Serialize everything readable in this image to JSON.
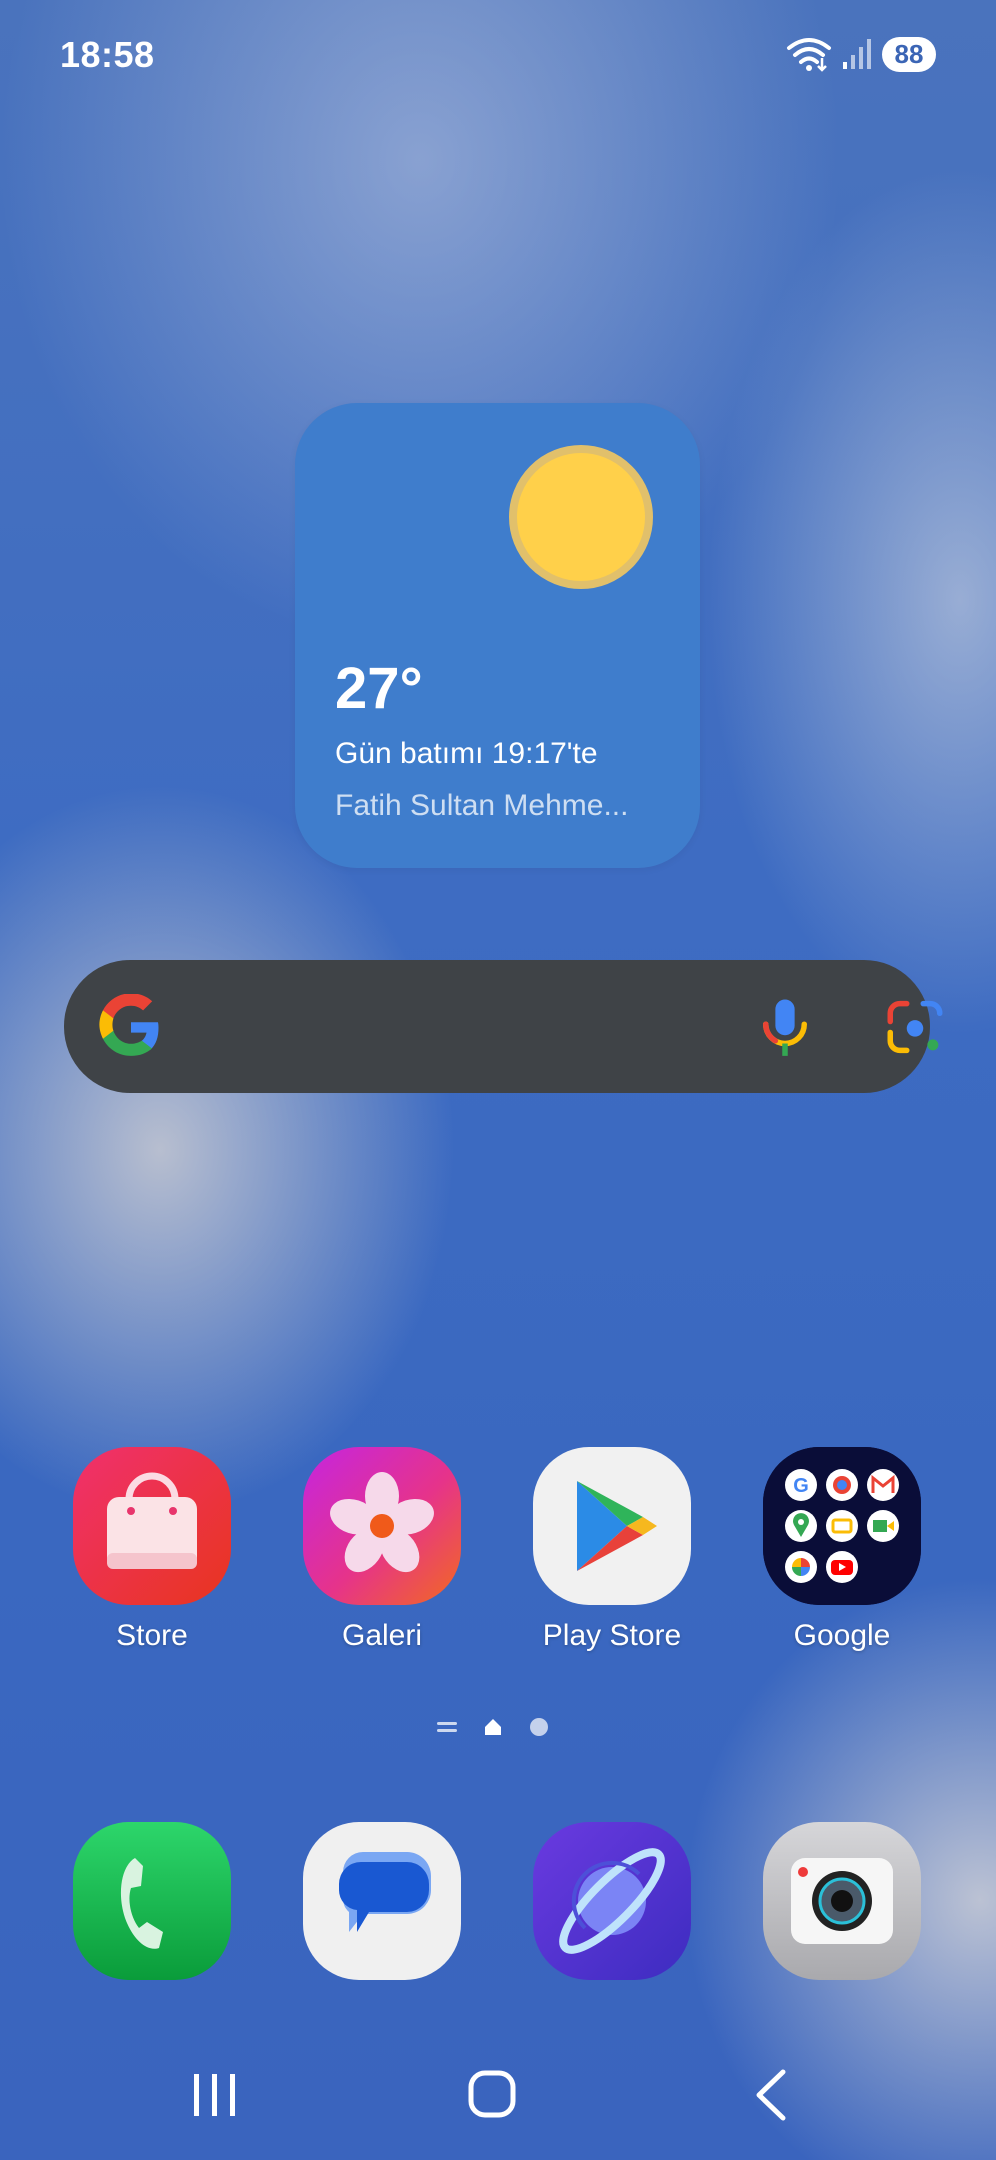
{
  "status_bar": {
    "time": "18:58",
    "battery": "88",
    "icons": [
      "wifi-icon",
      "signal-icon",
      "battery-icon"
    ]
  },
  "weather_widget": {
    "temperature": "27°",
    "sunset_text": "Gün batımı 19:17'te",
    "location": "Fatih Sultan Mehme..."
  },
  "search_bar": {
    "icons": [
      "google-logo-icon",
      "microphone-icon",
      "google-lens-icon"
    ]
  },
  "apps": [
    {
      "label": "Store",
      "icon": "store-bag-icon"
    },
    {
      "label": "Galeri",
      "icon": "gallery-flower-icon"
    },
    {
      "label": "Play Store",
      "icon": "play-store-icon"
    },
    {
      "label": "Google",
      "icon": "google-folder-icon"
    }
  ],
  "page_indicator": {
    "pages": [
      "list",
      "home",
      "page-2"
    ],
    "current": "home"
  },
  "dock": [
    {
      "icon": "phone-icon"
    },
    {
      "icon": "messages-icon"
    },
    {
      "icon": "internet-browser-icon"
    },
    {
      "icon": "camera-icon"
    }
  ],
  "nav_bar": [
    "recents-button",
    "home-button",
    "back-button"
  ],
  "colors": {
    "wallpaper": "#3e6cc2",
    "weather_widget": "#3f7dcc",
    "search_bar": "#3f4347",
    "sun": "#ffd04a"
  }
}
